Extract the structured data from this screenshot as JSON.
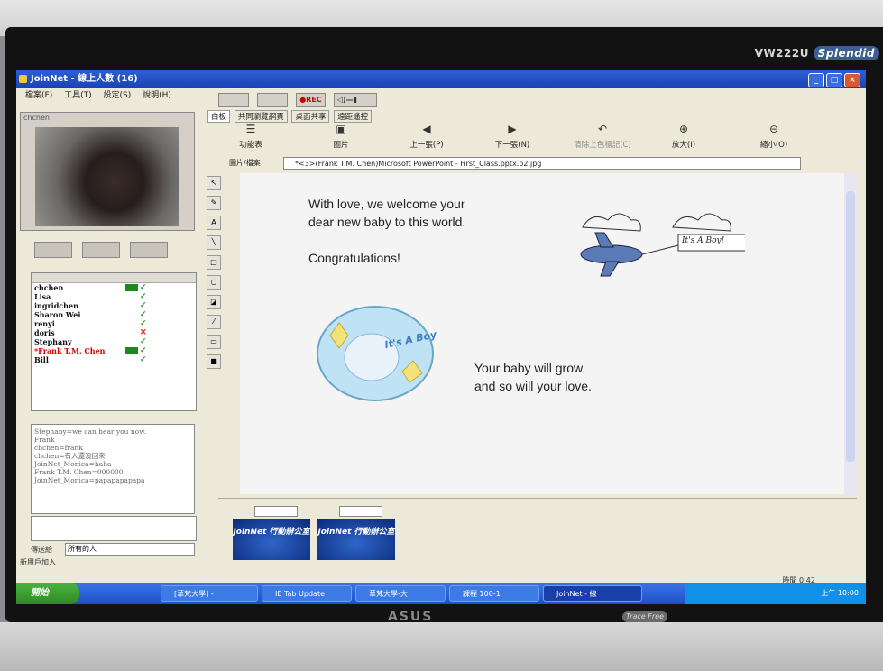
{
  "monitor": {
    "model": "VW222U",
    "brand_script": "Splendid",
    "maker": "ASUS",
    "trace": "Trace Free"
  },
  "window": {
    "title": "JoinNet - 線上人數 (16)"
  },
  "menu": [
    "檔案(F)",
    "工具(T)",
    "設定(S)",
    "說明(H)"
  ],
  "video": {
    "caption": "chchen"
  },
  "toolbar": {
    "rec": "●REC"
  },
  "tabs": [
    "白板",
    "共同瀏覽網頁",
    "桌面共享",
    "遠距遙控"
  ],
  "tools": [
    {
      "label": "功能表",
      "glyph": "☰"
    },
    {
      "label": "圖片",
      "glyph": "▣"
    },
    {
      "label": "上一張(P)",
      "glyph": "◀"
    },
    {
      "label": "下一張(N)",
      "glyph": "▶"
    },
    {
      "label": "清除上色標記(C)",
      "glyph": "↶"
    },
    {
      "label": "放大(I)",
      "glyph": "⊕"
    },
    {
      "label": "縮小(O)",
      "glyph": "⊖"
    }
  ],
  "path": {
    "label": "圖片/檔案",
    "value": "*<3>(Frank T.M. Chen)Microsoft PowerPoint - First_Class.pptx.p2.jpg"
  },
  "users": [
    {
      "name": "chchen",
      "status": "ok"
    },
    {
      "name": "Lisa",
      "status": "ok"
    },
    {
      "name": "ingridchen",
      "status": "ok"
    },
    {
      "name": "Sharon Wei",
      "status": "ok"
    },
    {
      "name": "renyi",
      "status": "ok"
    },
    {
      "name": "doris",
      "status": "bad"
    },
    {
      "name": "Stephany",
      "status": "ok"
    },
    {
      "name": "*Frank T.M. Chen",
      "status": "ok"
    },
    {
      "name": "Bill",
      "status": "ok"
    }
  ],
  "chat": [
    "Stephany=we can hear you now.",
    "Frank",
    "chchen=frank",
    "chchen=有人還沒回來",
    "JoinNet_Monica=haha",
    "Frank T.M. Chen=000000",
    "JoinNet_Monica=papapapapapa"
  ],
  "chat_send": {
    "label": "傳送給",
    "target": "所有的人"
  },
  "status_left": "新用戶加入",
  "slide": {
    "line1": "With love, we welcome your",
    "line2": "dear new baby to this world.",
    "line3": "Congratulations!",
    "line4": "Your baby will grow,",
    "line5": "and so will your love.",
    "banner": "It's A Boy!",
    "balloon": "It's A Boy"
  },
  "thumbs": [
    {
      "text": "JoinNet 行動辦公室"
    },
    {
      "text": "JoinNet 行動辦公室"
    }
  ],
  "time": "時間 0:42",
  "taskbar": {
    "start": "開始",
    "items": [
      "[華梵大學] -",
      "IE Tab Update",
      "華梵大學-大",
      "課程 100-1",
      "JoinNet - 線"
    ],
    "clock": "上午 10:00"
  }
}
